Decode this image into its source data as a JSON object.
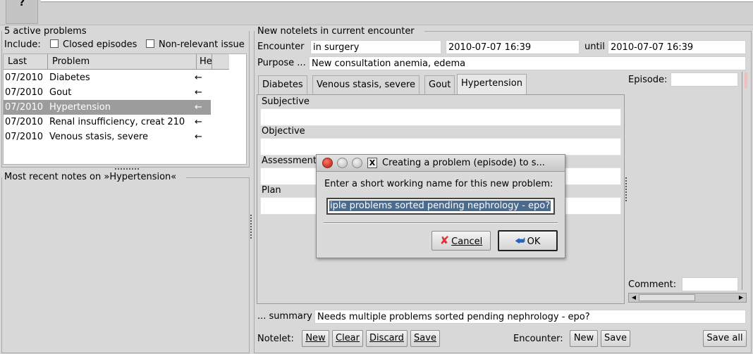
{
  "toolbar": {
    "help_label": "?"
  },
  "problems": {
    "title": "5 active problems",
    "include_label": "Include:",
    "closed_episodes": "Closed episodes",
    "non_relevant": "Non-relevant issue",
    "columns": [
      "Last",
      "Problem",
      "He"
    ],
    "rows": [
      {
        "last": "07/2010",
        "problem": "Diabetes",
        "arrow": "←"
      },
      {
        "last": "07/2010",
        "problem": "Gout",
        "arrow": "←"
      },
      {
        "last": "07/2010",
        "problem": "Hypertension",
        "arrow": "←"
      },
      {
        "last": "07/2010",
        "problem": "Renal insufficiency, creat 210",
        "arrow": "←"
      },
      {
        "last": "07/2010",
        "problem": "Venous stasis, severe",
        "arrow": "←"
      }
    ]
  },
  "recent_notes": {
    "title": "Most recent notes on »Hypertension«"
  },
  "notelets": {
    "title": "New notelets in current encounter",
    "encounter_label": "Encounter",
    "encounter_value": "in surgery",
    "start": "2010-07-07 16:39",
    "until_label": "until",
    "end": "2010-07-07 16:39",
    "purpose_label": "Purpose ...",
    "purpose_value": "New consultation anemia, edema",
    "tabs": [
      "Diabetes",
      "Venous stasis, severe",
      "Gout",
      "Hypertension"
    ],
    "soap": [
      "Subjective",
      "Objective",
      "Assessment",
      "Plan"
    ],
    "episode_label": "Episode:",
    "comment_label": "Comment:",
    "summary_label": "... summary",
    "summary_value": "Needs multiple problems sorted pending nephrology - epo?"
  },
  "bottom": {
    "notelet_label": "Notelet:",
    "new": "New",
    "clear": "Clear",
    "discard": "Discard",
    "save": "Save",
    "encounter_label": "Encounter:",
    "enc_new": "New",
    "enc_save": "Save",
    "save_all": "Save all"
  },
  "dialog": {
    "title": "Creating a problem (episode) to s...",
    "prompt": "Enter a short working name for this new problem:",
    "input_value": "iple problems sorted pending nephrology - epo?",
    "cancel": "Cancel",
    "ok": "OK",
    "close_glyph": "X"
  },
  "colors": {
    "selection": "#9c9c9c",
    "dialog_input_selection": "#4a6a8e",
    "close_button": "#d93a2e"
  }
}
